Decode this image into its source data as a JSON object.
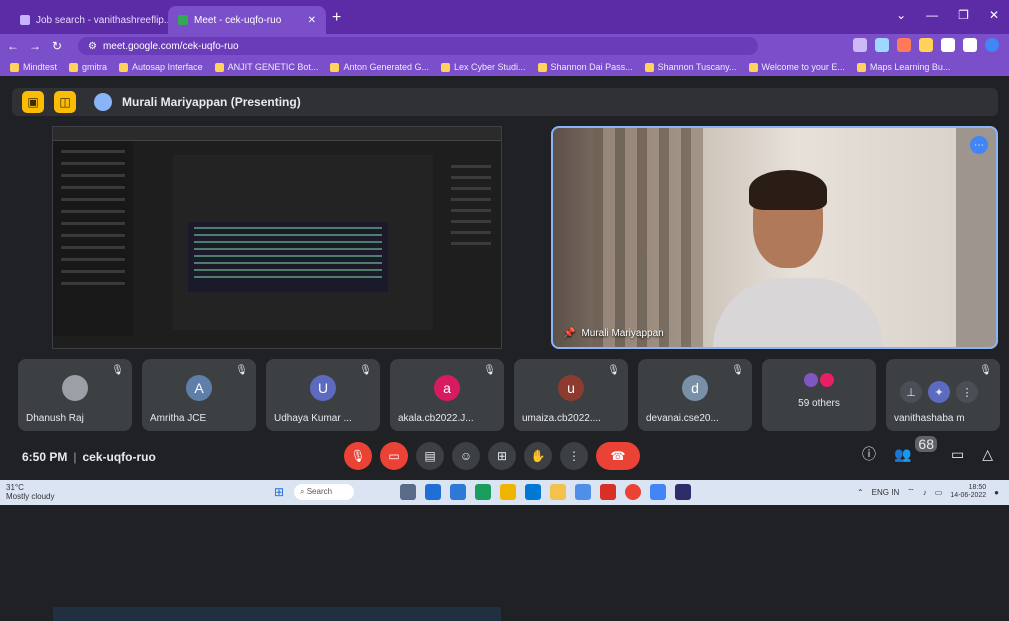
{
  "browser": {
    "tabs": [
      {
        "label": "Job search - vanithashreeflip... "
      },
      {
        "label": "Meet - cek-uqfo-ruo"
      }
    ],
    "url": "meet.google.com/cek-uqfo-ruo",
    "bookmarks": [
      "Mindtest",
      "gmitra",
      "Autosap Interface",
      "ANJIT GENETIC Bot...",
      "Anton Generated G...",
      "Lex Cyber Studi...",
      "Shannon Dai Pass...",
      "Shannon Tuscany...",
      "Welcome to your E...",
      "Maps Learning Bu..."
    ]
  },
  "meet": {
    "presenter": "Murali Mariyappan (Presenting)",
    "camera_label": "Murali Mariyappan",
    "tiles": [
      {
        "name": "Dhanush Raj",
        "initial": "",
        "color": "#5f6368"
      },
      {
        "name": "Amritha JCE",
        "initial": "A",
        "color": "#5f7fa8"
      },
      {
        "name": "Udhaya Kumar ...",
        "initial": "U",
        "color": "#5c6bc0"
      },
      {
        "name": "akala.cb2022.J...",
        "initial": "a",
        "color": "#d81b60"
      },
      {
        "name": "umaiza.cb2022....",
        "initial": "u",
        "color": "#8d3b2e"
      },
      {
        "name": "devanai.cse20...",
        "initial": "d",
        "color": "#7890a8"
      }
    ],
    "others_label": "59 others",
    "last_tile": "vanithashaba m",
    "time": "6:50 PM",
    "meeting_code": "cek-uqfo-ruo",
    "participants_badge": "68"
  },
  "taskbar": {
    "weather_temp": "31°C",
    "weather_desc": "Mostly cloudy",
    "search": "Search",
    "lang": "ENG",
    "lang2": "IN",
    "time": "18:50",
    "date": "14-06-2022"
  }
}
